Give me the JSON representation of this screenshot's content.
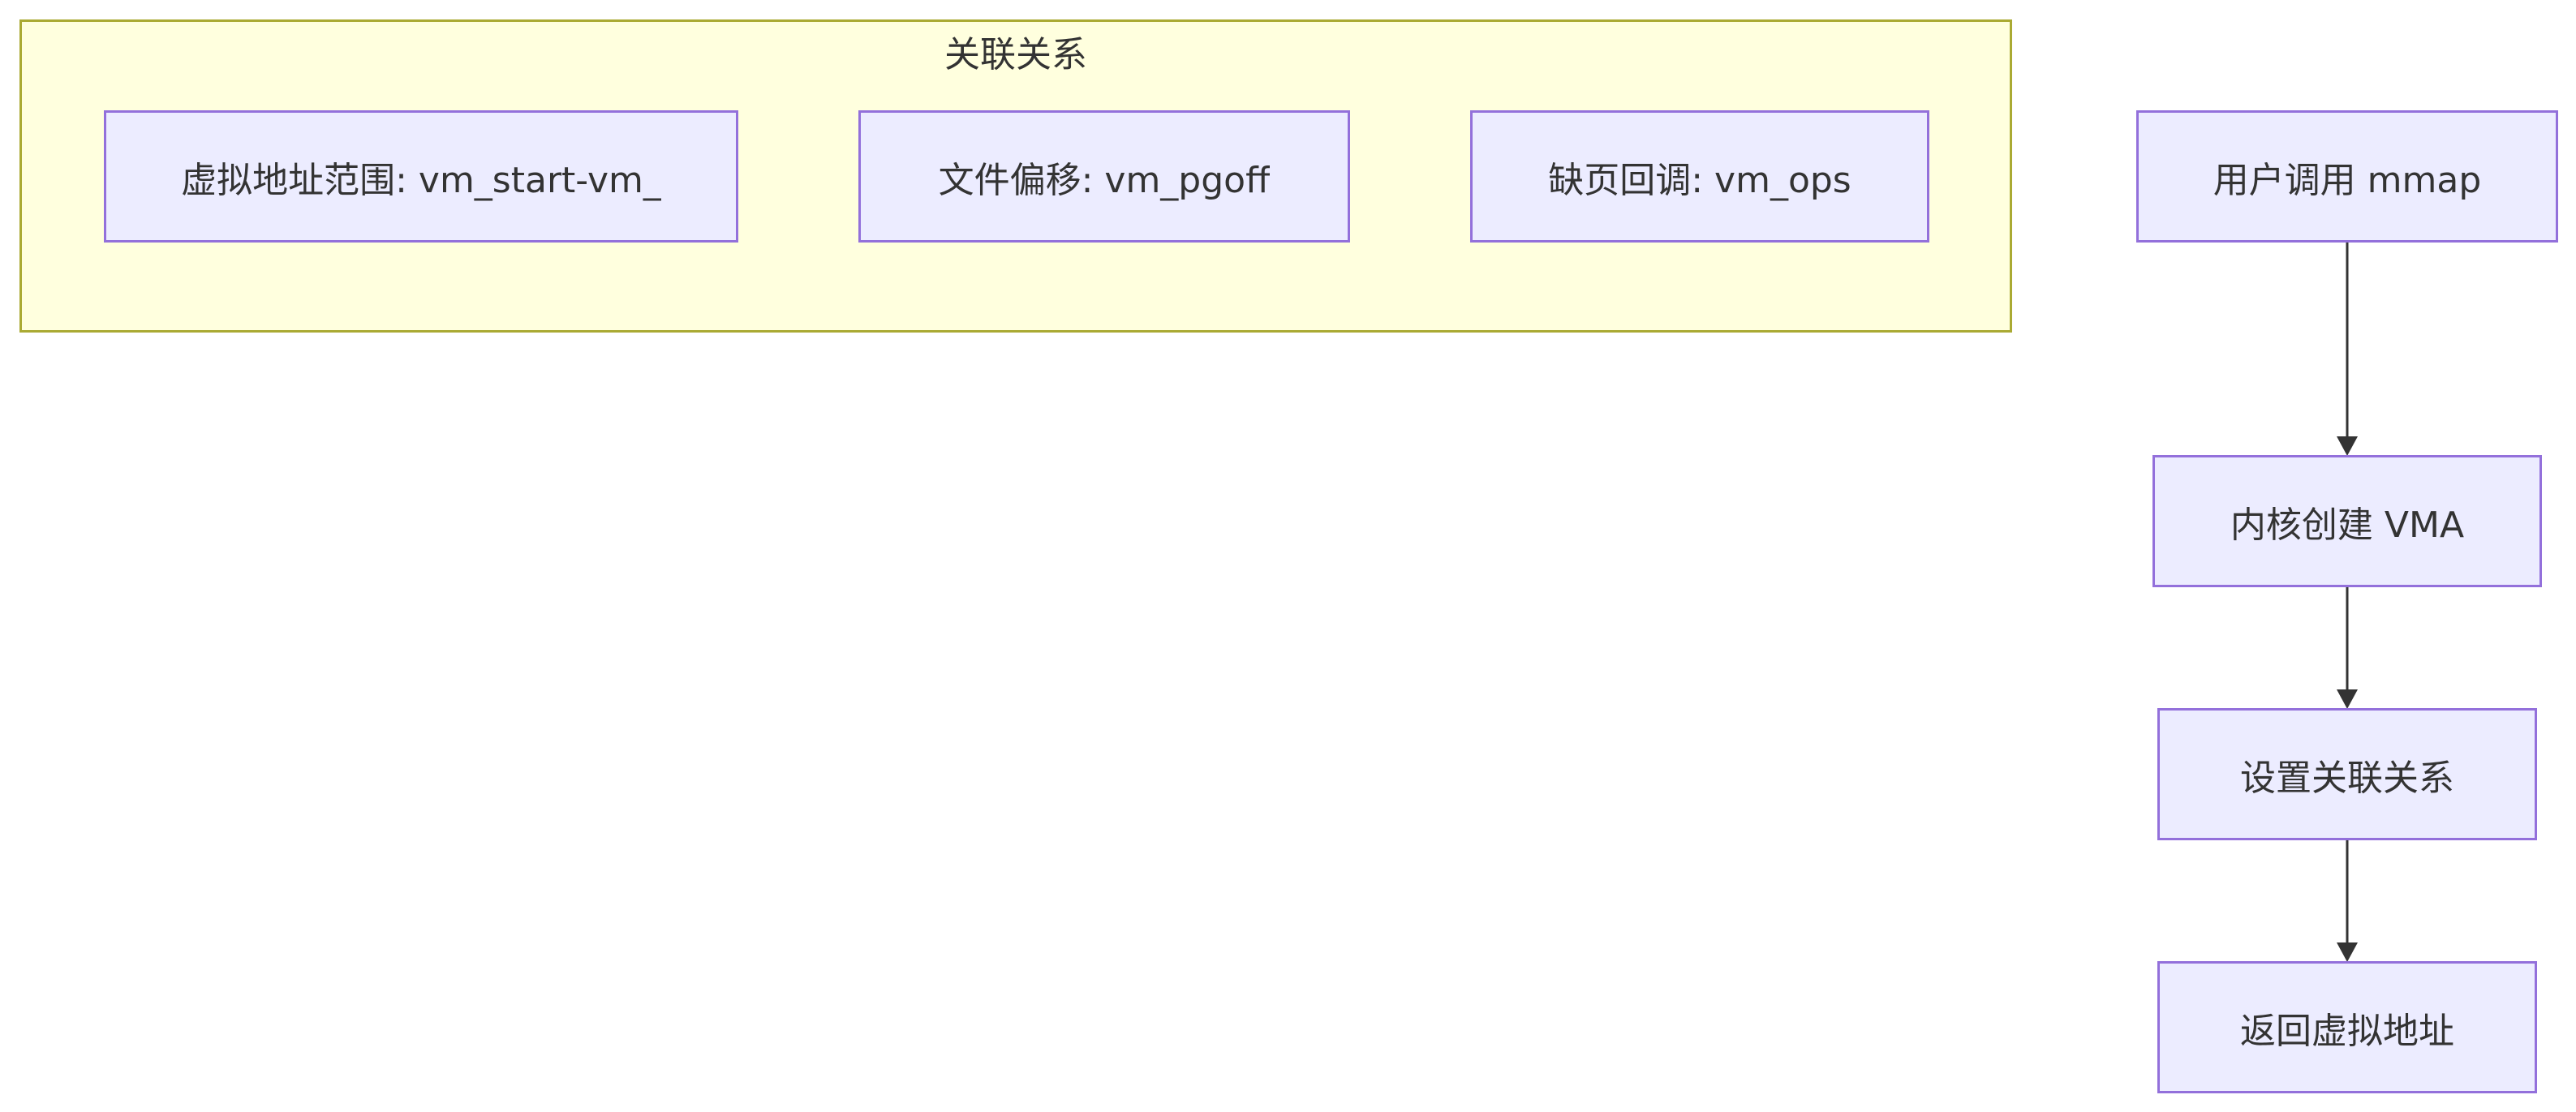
{
  "diagram": {
    "cluster": {
      "title": "关联关系",
      "nodes": [
        {
          "id": "vaddr_range",
          "label": "虚拟地址范围: vm_start-vm_"
        },
        {
          "id": "file_offset",
          "label": "文件偏移: vm_pgoff"
        },
        {
          "id": "fault_callback",
          "label": "缺页回调: vm_ops"
        }
      ]
    },
    "flow": {
      "nodes": [
        {
          "id": "user_mmap",
          "label": "用户调用 mmap"
        },
        {
          "id": "kernel_vma",
          "label": "内核创建 VMA"
        },
        {
          "id": "set_relation",
          "label": "设置关联关系"
        },
        {
          "id": "return_vaddr",
          "label": "返回虚拟地址"
        }
      ],
      "edges": [
        {
          "from": "user_mmap",
          "to": "kernel_vma"
        },
        {
          "from": "kernel_vma",
          "to": "set_relation"
        },
        {
          "from": "set_relation",
          "to": "return_vaddr"
        }
      ]
    },
    "colors": {
      "node_fill": "#ececff",
      "node_stroke": "#9370db",
      "cluster_fill": "#ffffde",
      "cluster_stroke": "#aaaa33",
      "edge": "#333333",
      "text": "#333333"
    }
  }
}
